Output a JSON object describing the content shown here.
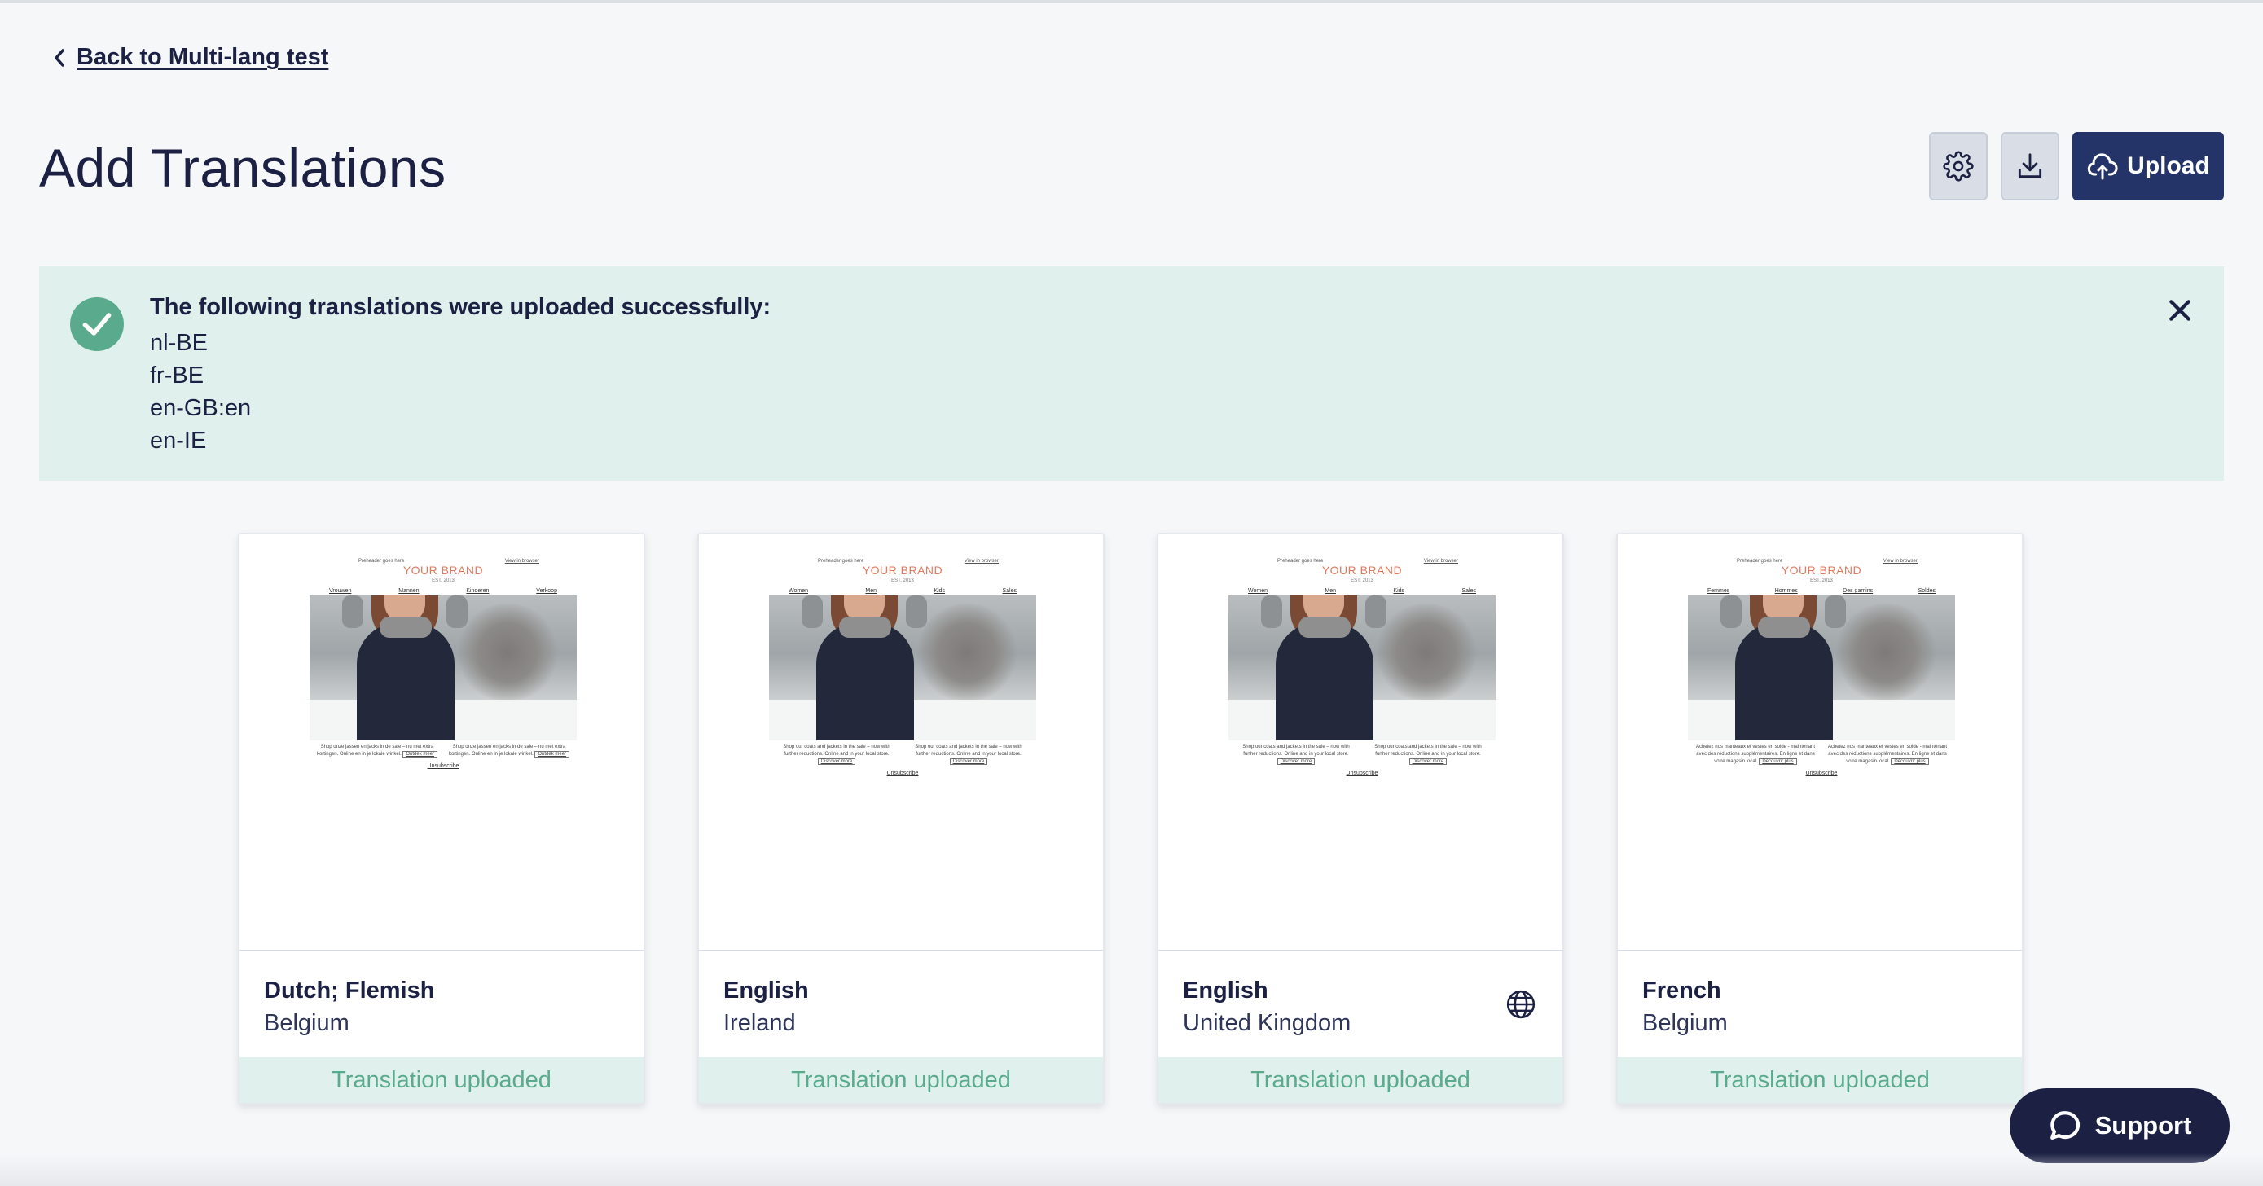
{
  "nav": {
    "back_label": "Back to Multi-lang test"
  },
  "header": {
    "title": "Add Translations",
    "upload_label": "Upload"
  },
  "alert": {
    "title": "The following translations were uploaded successfully:",
    "items": [
      "nl-BE",
      "fr-BE",
      "en-GB:en",
      "en-IE"
    ]
  },
  "cards": [
    {
      "language": "Dutch; Flemish",
      "country": "Belgium",
      "status": "Translation uploaded",
      "has_globe": false,
      "preview": {
        "preheader": "Preheader goes here",
        "view_browser": "View in browser",
        "brand": "YOUR BRAND",
        "est": "EST. 2013",
        "nav": [
          "Vrouwen",
          "Mannen",
          "Kinderen",
          "Verkoop"
        ],
        "col_text": "Shop onze jassen en jacks in de sale – nu met extra kortingen. Online en in je lokale winkel.",
        "col_button": "Ontdek meer",
        "unsubscribe": "Unsubscribe"
      }
    },
    {
      "language": "English",
      "country": "Ireland",
      "status": "Translation uploaded",
      "has_globe": false,
      "preview": {
        "preheader": "Preheader goes here",
        "view_browser": "View in browser",
        "brand": "YOUR BRAND",
        "est": "EST. 2013",
        "nav": [
          "Women",
          "Men",
          "Kids",
          "Sales"
        ],
        "col_text": "Shop our coats and jackets in the sale – now with further reductions. Online and in your local store.",
        "col_button": "Discover more",
        "unsubscribe": "Unsubscribe"
      }
    },
    {
      "language": "English",
      "country": "United Kingdom",
      "status": "Translation uploaded",
      "has_globe": true,
      "preview": {
        "preheader": "Preheader goes here",
        "view_browser": "View in browser",
        "brand": "YOUR BRAND",
        "est": "EST. 2013",
        "nav": [
          "Women",
          "Men",
          "Kids",
          "Sales"
        ],
        "col_text": "Shop our coats and jackets in the sale – now with further reductions. Online and in your local store.",
        "col_button": "Discover more",
        "unsubscribe": "Unsubscribe"
      }
    },
    {
      "language": "French",
      "country": "Belgium",
      "status": "Translation uploaded",
      "has_globe": false,
      "preview": {
        "preheader": "Preheader goes here",
        "view_browser": "View in browser",
        "brand": "YOUR BRAND",
        "est": "EST. 2013",
        "nav": [
          "Femmes",
          "Hommes",
          "Des gamins",
          "Soldes"
        ],
        "col_text": "Achetez nos manteaux et vestes en solde - maintenant avec des réductions supplémentaires. En ligne et dans votre magasin local.",
        "col_button": "Découvrir plus",
        "unsubscribe": "Unsubscribe"
      }
    }
  ],
  "support": {
    "label": "Support"
  },
  "colors": {
    "navy": "#1c2144",
    "upload_button": "#253468",
    "success_bg": "#e0f0ec",
    "success_text": "#5aab8d",
    "brand_orange": "#e07a5f"
  }
}
